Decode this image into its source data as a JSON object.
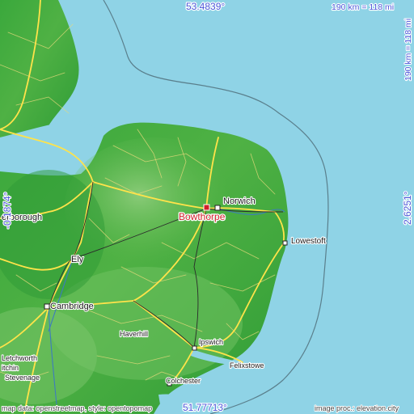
{
  "colors": {
    "sea": "#8fd3e6",
    "land_low": "#2f9e35",
    "land_mid": "#4caf3f",
    "land_high": "#74c365",
    "road": "#f2e05a",
    "highlight": "#d0202a",
    "coord_text": "#4a56d8"
  },
  "coords": {
    "top_lat": "53.4839°",
    "bottom_lat": "51.77713°",
    "left_lon": "-0.1874°",
    "right_lon": "2.6251°"
  },
  "scale": {
    "horizontal": "190 km = 118 mi",
    "vertical": "190 km = 118 mi"
  },
  "highlight_place": {
    "name": "Bowthorpe"
  },
  "places": [
    {
      "id": "norwich",
      "name": "Norwich"
    },
    {
      "id": "lowestoft",
      "name": "Lowestoft"
    },
    {
      "id": "ely",
      "name": "Ely"
    },
    {
      "id": "cambridge",
      "name": "Cambridge"
    },
    {
      "id": "peterborough",
      "name": "erborough"
    },
    {
      "id": "haverhill",
      "name": "Haverhill"
    },
    {
      "id": "ipswich",
      "name": "Ipswich"
    },
    {
      "id": "felixstowe",
      "name": "Felixstowe"
    },
    {
      "id": "colchester",
      "name": "Colchester"
    },
    {
      "id": "letchworth",
      "name": "Letchworth"
    },
    {
      "id": "hitchin",
      "name": "itchin"
    },
    {
      "id": "stevenage",
      "name": "Stevenage"
    }
  ],
  "credits": {
    "left": "map data: openstreetmap, style: opentopomap",
    "right": "image proc.: elevation.city"
  }
}
